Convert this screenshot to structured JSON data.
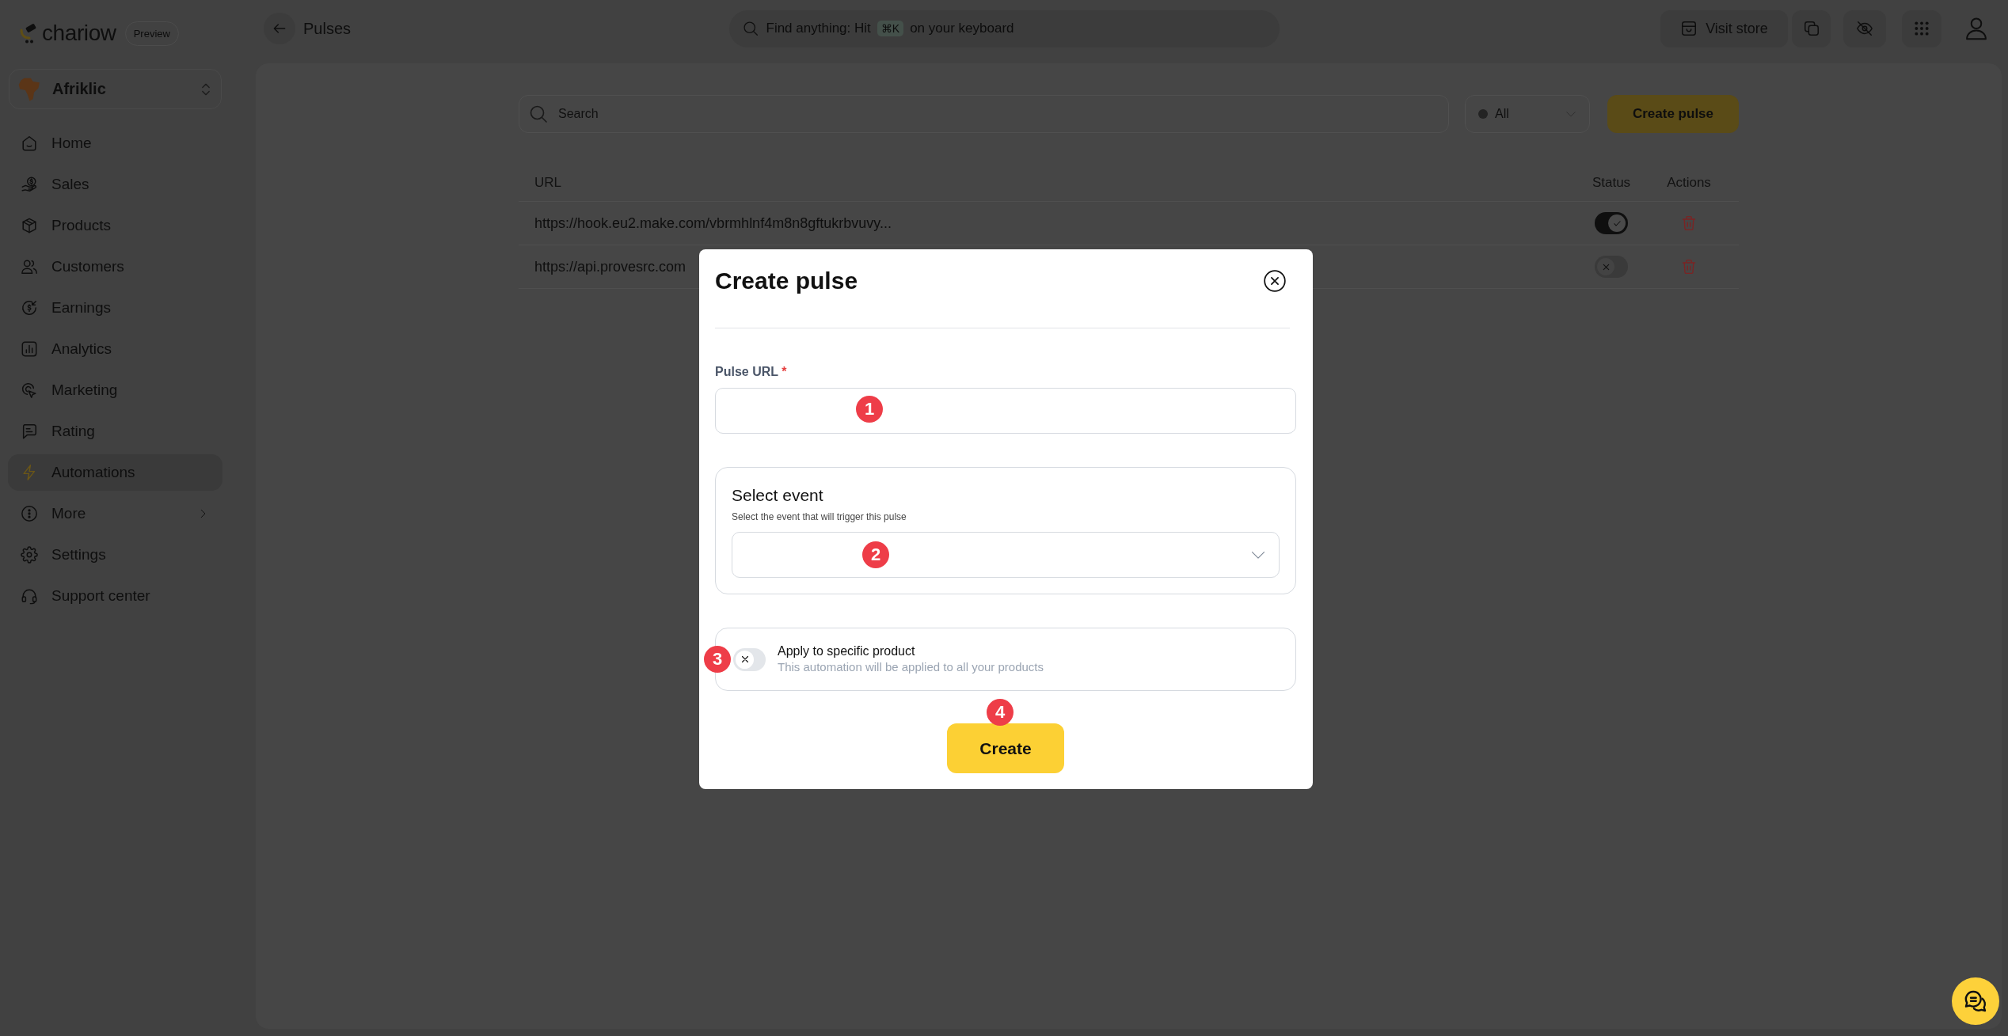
{
  "brand": {
    "name": "chariow",
    "tag": "Preview"
  },
  "header": {
    "title": "Pulses",
    "search": {
      "hint_start": "Find anything: Hit",
      "shortcut": "⌘K",
      "hint_end": "on your keyboard"
    },
    "visit_store": "Visit store"
  },
  "workspace": {
    "name": "Afriklic"
  },
  "sidebar": {
    "items": [
      {
        "label": "Home",
        "selected": false,
        "submenu": false
      },
      {
        "label": "Sales",
        "selected": false,
        "submenu": false
      },
      {
        "label": "Products",
        "selected": false,
        "submenu": false
      },
      {
        "label": "Customers",
        "selected": false,
        "submenu": false
      },
      {
        "label": "Earnings",
        "selected": false,
        "submenu": false
      },
      {
        "label": "Analytics",
        "selected": false,
        "submenu": false
      },
      {
        "label": "Marketing",
        "selected": false,
        "submenu": false
      },
      {
        "label": "Rating",
        "selected": false,
        "submenu": false
      },
      {
        "label": "Automations",
        "selected": true,
        "submenu": false
      },
      {
        "label": "More",
        "selected": false,
        "submenu": true
      },
      {
        "label": "Settings",
        "selected": false,
        "submenu": false
      },
      {
        "label": "Support center",
        "selected": false,
        "submenu": false
      }
    ]
  },
  "toolbar": {
    "search": {
      "placeholder": "Search"
    },
    "filter": {
      "value": "All"
    },
    "create_button": "Create pulse"
  },
  "table": {
    "columns": [
      "URL",
      "Status",
      "Actions"
    ],
    "rows": [
      {
        "url": "https://hook.eu2.make.com/vbrmhlnf4m8n8gftukrbvuvy...",
        "active": true
      },
      {
        "url": "https://api.provesrc.com",
        "active": false
      }
    ]
  },
  "modal": {
    "title": "Create pulse",
    "url_field": {
      "label": "Pulse URL",
      "required_mark": "*",
      "step_marker": "1"
    },
    "event_field": {
      "title": "Select event",
      "description": "Select the event that will trigger this pulse",
      "step_marker": "2"
    },
    "product_option": {
      "title": "Apply to specific product",
      "description": "This automation will be applied to all your products",
      "on": false,
      "step_marker": "3"
    },
    "submit": {
      "label": "Create",
      "step_marker": "4"
    }
  }
}
